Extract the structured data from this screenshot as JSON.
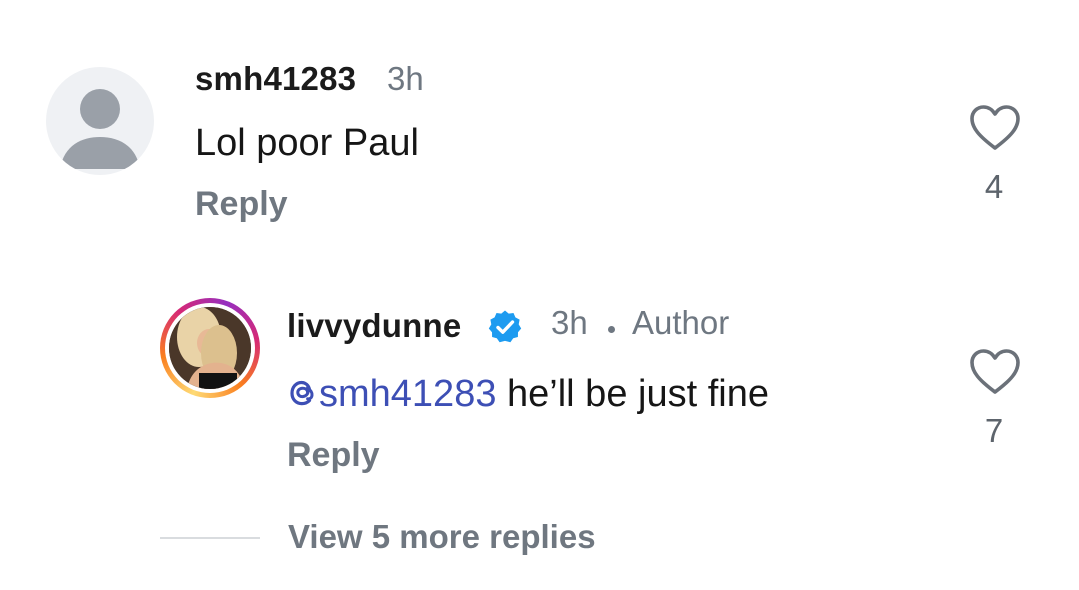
{
  "comments": [
    {
      "username": "smh41283",
      "time": "3h",
      "text": "Lol poor Paul",
      "reply_label": "Reply",
      "like_count": "4",
      "avatar_icon": "default-avatar-icon",
      "like_icon": "heart-outline-icon"
    },
    {
      "username": "livvydunne",
      "verified_icon": "verified-badge-icon",
      "time": "3h",
      "author_tag": "Author",
      "mention": "smh41283",
      "mention_icon": "threads-at-icon",
      "text": " he’ll be just fine",
      "reply_label": "Reply",
      "like_count": "7",
      "like_icon": "heart-outline-icon"
    }
  ],
  "view_more_replies": "View 5 more replies",
  "colors": {
    "verified": "#1d9bf0",
    "mention": "#3d4fb5",
    "muted": "#6e7781",
    "ring_gradient": [
      "#feda75",
      "#fa7e1e",
      "#d62976",
      "#962fbf"
    ]
  }
}
